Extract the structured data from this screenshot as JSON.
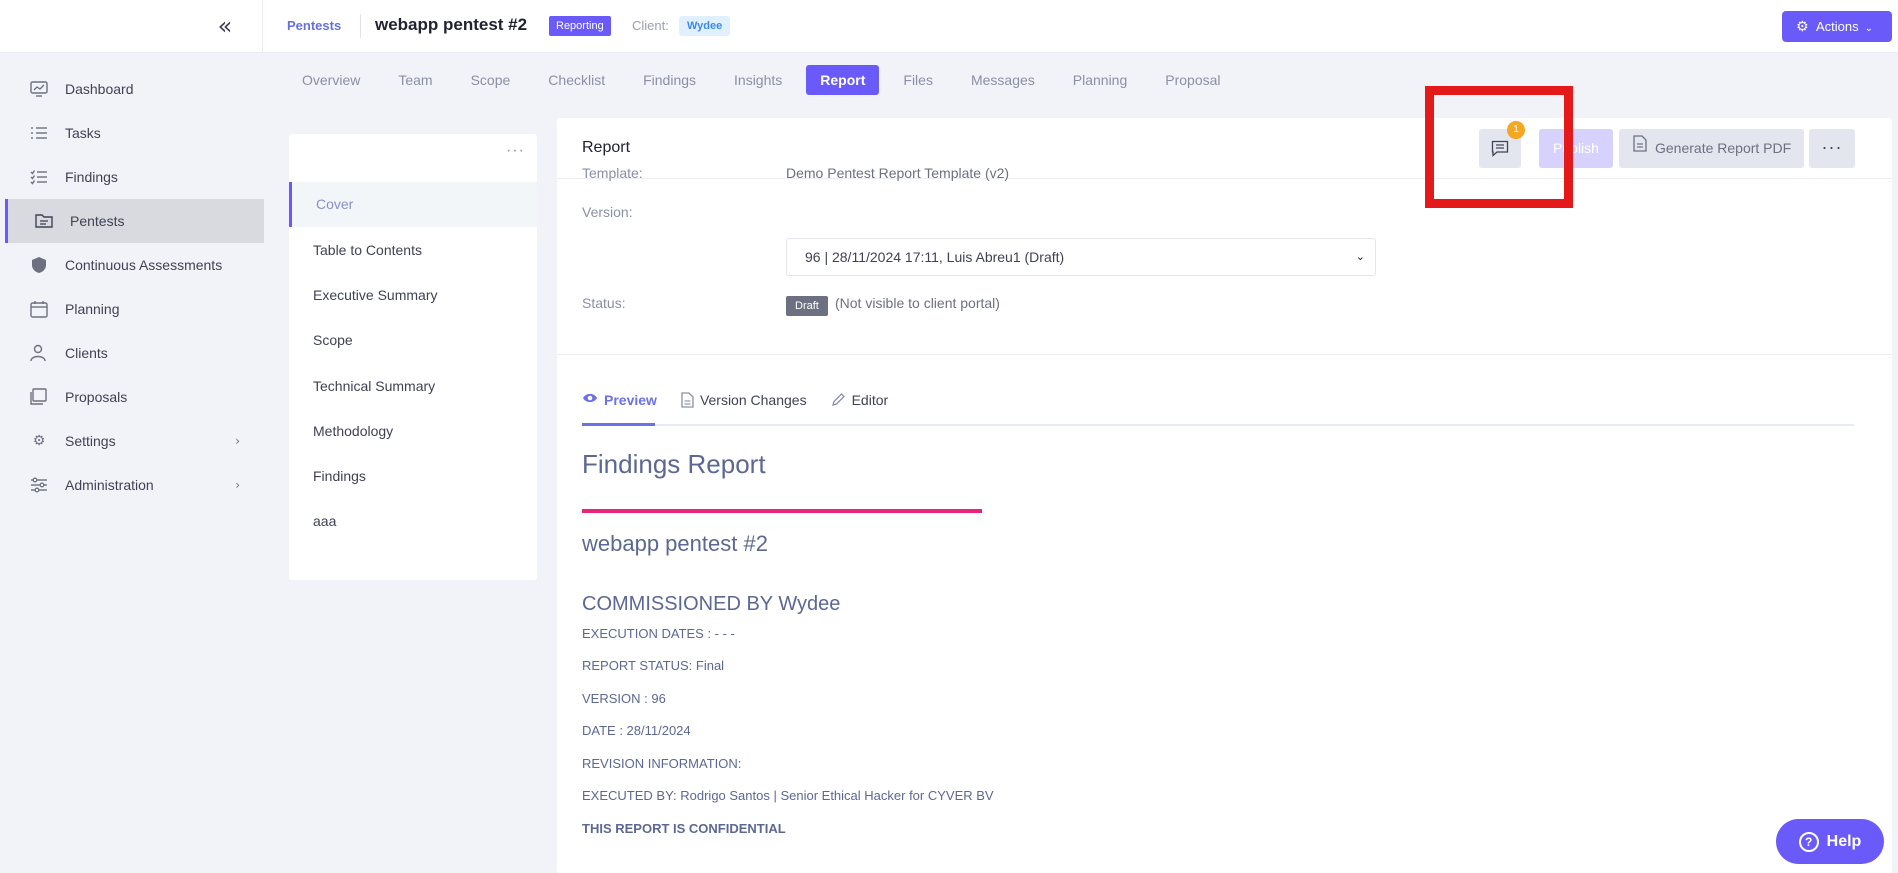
{
  "header": {
    "breadcrumb": "Pentests",
    "title": "webapp pentest #2",
    "status_badge": "Reporting",
    "client_label": "Client:",
    "client_name": "Wydee",
    "actions_label": "Actions"
  },
  "sidebar": {
    "items": [
      {
        "label": "Dashboard"
      },
      {
        "label": "Tasks"
      },
      {
        "label": "Findings"
      },
      {
        "label": "Pentests"
      },
      {
        "label": "Continuous Assessments"
      },
      {
        "label": "Planning"
      },
      {
        "label": "Clients"
      },
      {
        "label": "Proposals"
      },
      {
        "label": "Settings"
      },
      {
        "label": "Administration"
      }
    ]
  },
  "tabs": [
    "Overview",
    "Team",
    "Scope",
    "Checklist",
    "Findings",
    "Insights",
    "Report",
    "Files",
    "Messages",
    "Planning",
    "Proposal"
  ],
  "toc": [
    "Cover",
    "Table to Contents",
    "Executive Summary",
    "Scope",
    "Technical Summary",
    "Methodology",
    "Findings",
    "aaa"
  ],
  "report": {
    "title": "Report",
    "comment_count": "1",
    "publish_label": "Publish",
    "pdf_label": "Generate Report PDF",
    "template_label": "Template:",
    "template_value": "Demo Pentest Report Template (v2)",
    "version_label": "Version:",
    "version_value": "96 | 28/11/2024 17:11, Luis Abreu1 (Draft)",
    "status_label": "Status:",
    "status_badge": "Draft",
    "status_note": "(Not visible to client portal)",
    "subtabs": [
      "Preview",
      "Version Changes",
      "Editor"
    ]
  },
  "document": {
    "h1": "Findings Report",
    "h2": "webapp pentest #2",
    "h3": "COMMISSIONED BY Wydee",
    "lines": [
      "EXECUTION DATES : - - -",
      "REPORT STATUS: Final",
      "VERSION : 96",
      "DATE : 28/11/2024",
      "REVISION INFORMATION:",
      "EXECUTED BY: Rodrigo Santos | Senior Ethical Hacker for CYVER BV",
      "THIS REPORT IS CONFIDENTIAL"
    ]
  },
  "help_label": "Help"
}
